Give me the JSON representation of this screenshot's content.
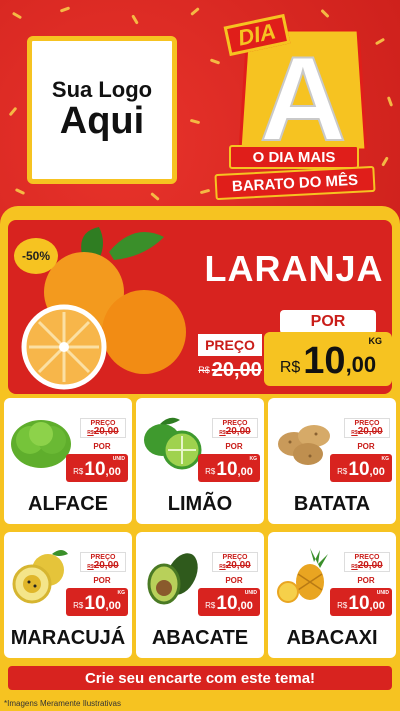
{
  "header": {
    "logo_top": "Sua Logo",
    "logo_main": "Aqui",
    "badge": "DIA",
    "big_letter": "A",
    "tagline_1": "O DIA MAIS",
    "tagline_2": "BARATO DO MÊS"
  },
  "hero": {
    "discount": "-50%",
    "name": "LARANJA",
    "preco_label": "PREÇO",
    "old_currency": "R$",
    "old_price": "20,00",
    "por_label": "POR",
    "currency": "R$",
    "price_int": "10",
    "price_dec": ",00",
    "unit": "KG"
  },
  "products": [
    {
      "name": "ALFACE",
      "preco_label": "PREÇO",
      "old_currency": "R$",
      "old_price": "20,00",
      "por_label": "POR",
      "currency": "R$",
      "price_int": "10",
      "price_dec": ",00",
      "unit": "UNID",
      "icon": "lettuce-icon"
    },
    {
      "name": "LIMÃO",
      "preco_label": "PREÇO",
      "old_currency": "R$",
      "old_price": "20,00",
      "por_label": "POR",
      "currency": "R$",
      "price_int": "10",
      "price_dec": ",00",
      "unit": "KG",
      "icon": "lime-icon"
    },
    {
      "name": "BATATA",
      "preco_label": "PREÇO",
      "old_currency": "R$",
      "old_price": "20,00",
      "por_label": "POR",
      "currency": "R$",
      "price_int": "10",
      "price_dec": ",00",
      "unit": "KG",
      "icon": "potato-icon"
    },
    {
      "name": "MARACUJÁ",
      "preco_label": "PREÇO",
      "old_currency": "R$",
      "old_price": "20,00",
      "por_label": "POR",
      "currency": "R$",
      "price_int": "10",
      "price_dec": ",00",
      "unit": "KG",
      "icon": "passion-fruit-icon"
    },
    {
      "name": "ABACATE",
      "preco_label": "PREÇO",
      "old_currency": "R$",
      "old_price": "20,00",
      "por_label": "POR",
      "currency": "R$",
      "price_int": "10",
      "price_dec": ",00",
      "unit": "UNID",
      "icon": "avocado-icon"
    },
    {
      "name": "ABACAXI",
      "preco_label": "PREÇO",
      "old_currency": "R$",
      "old_price": "20,00",
      "por_label": "POR",
      "currency": "R$",
      "price_int": "10",
      "price_dec": ",00",
      "unit": "UNID",
      "icon": "pineapple-icon"
    }
  ],
  "cta": "Crie seu encarte com este tema!",
  "footnote": "*Imagens Meramente Ilustrativas",
  "colors": {
    "red": "#d8231f",
    "yellow": "#f6c321",
    "white": "#ffffff"
  }
}
